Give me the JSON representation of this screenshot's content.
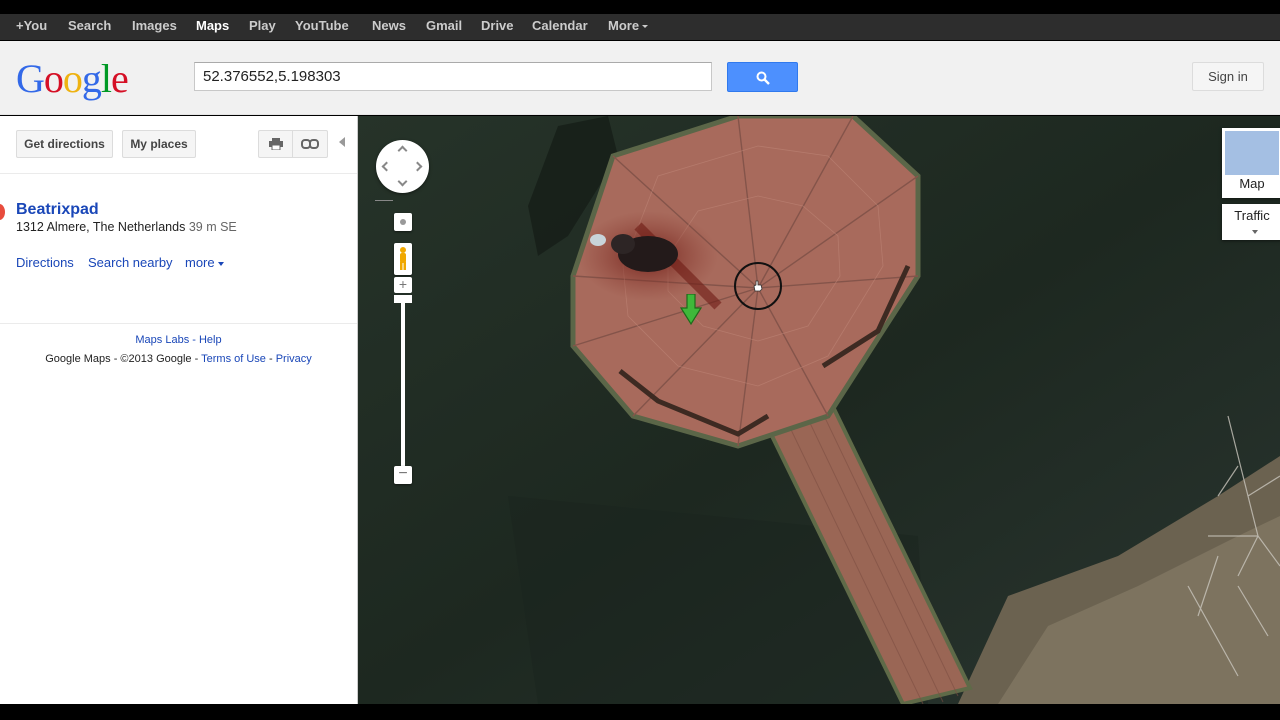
{
  "topnav": {
    "items": [
      "+You",
      "Search",
      "Images",
      "Maps",
      "Play",
      "YouTube",
      "News",
      "Gmail",
      "Drive",
      "Calendar",
      "More"
    ],
    "active": "Maps"
  },
  "header": {
    "logo": "Google",
    "search_value": "52.376552,5.198303",
    "signin_label": "Sign in"
  },
  "panel": {
    "get_directions_label": "Get directions",
    "my_places_label": "My places",
    "place": {
      "name": "Beatrixpad",
      "address": "1312 Almere, The Netherlands",
      "distance": "39 m SE"
    },
    "links": {
      "directions": "Directions",
      "search_nearby": "Search nearby",
      "more": "more"
    },
    "footer": {
      "labs": "Maps Labs",
      "help": "Help",
      "copyright": "Google Maps - ©2013 Google -",
      "terms": "Terms of Use",
      "privacy": "Privacy"
    }
  },
  "map": {
    "mode_label": "Map",
    "traffic_label": "Traffic",
    "zoom_in": "+",
    "zoom_out": "−"
  },
  "colors": {
    "link": "#1a47b8",
    "search_button": "#4d90fe",
    "water": "#1f2a22",
    "deck": "#a86a5c"
  }
}
